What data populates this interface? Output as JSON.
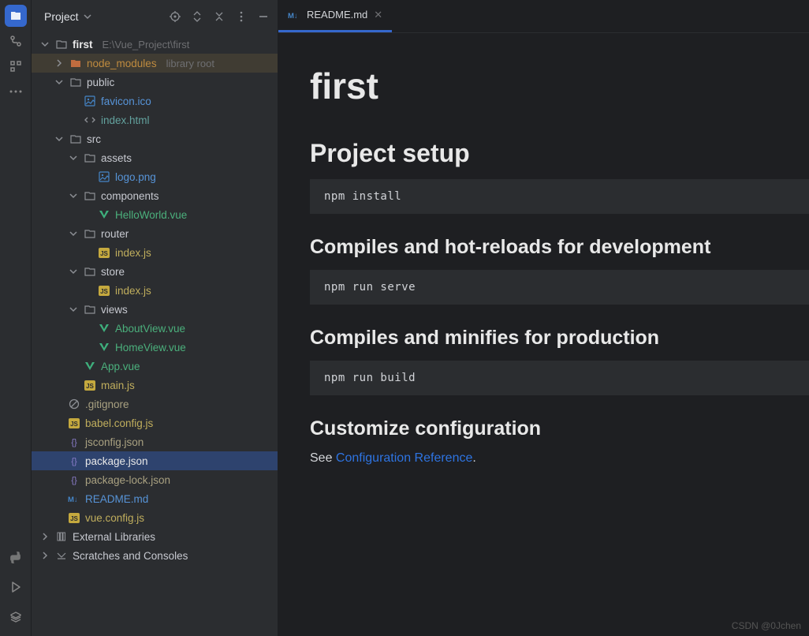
{
  "activity": {
    "top": [
      "project",
      "vcs",
      "structure",
      "more"
    ],
    "bottom": [
      "python",
      "run",
      "stack"
    ]
  },
  "sidebar": {
    "title": "Project",
    "root": {
      "name": "first",
      "path": "E:\\Vue_Project\\first"
    },
    "nodeModules": {
      "name": "node_modules",
      "note": "library root"
    },
    "public": {
      "name": "public",
      "files": {
        "favicon": "favicon.ico",
        "index": "index.html"
      }
    },
    "src": {
      "name": "src",
      "assets": {
        "name": "assets",
        "logo": "logo.png"
      },
      "components": {
        "name": "components",
        "hello": "HelloWorld.vue"
      },
      "router": {
        "name": "router",
        "index": "index.js"
      },
      "store": {
        "name": "store",
        "index": "index.js"
      },
      "views": {
        "name": "views",
        "about": "AboutView.vue",
        "home": "HomeView.vue"
      },
      "app": "App.vue",
      "main": "main.js"
    },
    "rootFiles": {
      "gitignore": ".gitignore",
      "babel": "babel.config.js",
      "jsconfig": "jsconfig.json",
      "package": "package.json",
      "packageLock": "package-lock.json",
      "readme": "README.md",
      "vueconfig": "vue.config.js"
    },
    "external": "External Libraries",
    "scratches": "Scratches and Consoles"
  },
  "tab": {
    "label": "README.md"
  },
  "readme": {
    "title": "first",
    "h_setup": "Project setup",
    "code1": "npm install",
    "h_dev": "Compiles and hot-reloads for development",
    "code2": "npm run serve",
    "h_prod": "Compiles and minifies for production",
    "code3": "npm run build",
    "h_custom": "Customize configuration",
    "see": "See ",
    "link": "Configuration Reference",
    "dot": "."
  },
  "watermark": "CSDN @0Jchen"
}
